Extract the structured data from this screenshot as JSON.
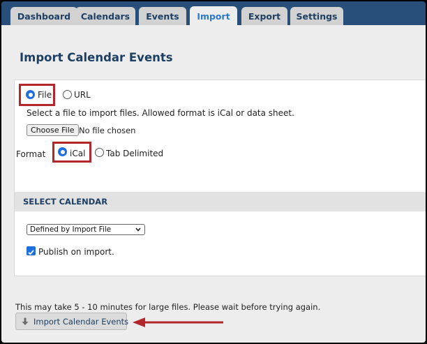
{
  "tabs": [
    {
      "label": "Dashboard",
      "active": false
    },
    {
      "label": "Calendars",
      "active": false
    },
    {
      "label": "Events",
      "active": false
    },
    {
      "label": "Import",
      "active": true
    },
    {
      "label": "Export",
      "active": false
    },
    {
      "label": "Settings",
      "active": false
    }
  ],
  "page": {
    "title": "Import Calendar Events"
  },
  "source": {
    "options": [
      {
        "label": "File",
        "selected": true
      },
      {
        "label": "URL",
        "selected": false
      }
    ],
    "instructions": "Select a file to import files. Allowed format is iCal or data sheet.",
    "choose_file_label": "Choose File",
    "no_file_text": "No file chosen"
  },
  "format": {
    "label": "Format",
    "options": [
      {
        "label": "iCal",
        "selected": true
      },
      {
        "label": "Tab Delimited",
        "selected": false
      }
    ]
  },
  "select_calendar": {
    "heading": "SELECT CALENDAR",
    "dropdown_value": "Defined by Import File",
    "publish_label": "Publish on import.",
    "publish_checked": true
  },
  "footer": {
    "note": "This may take 5 - 10 minutes for large files. Please wait before trying again.",
    "import_button_label": "Import Calendar Events"
  },
  "colors": {
    "nav_bar": "#284f7a",
    "heading": "#1d3f63",
    "active_tab_text": "#2b79c8",
    "highlight": "#b3262b",
    "accent": "#1e6ee0"
  }
}
